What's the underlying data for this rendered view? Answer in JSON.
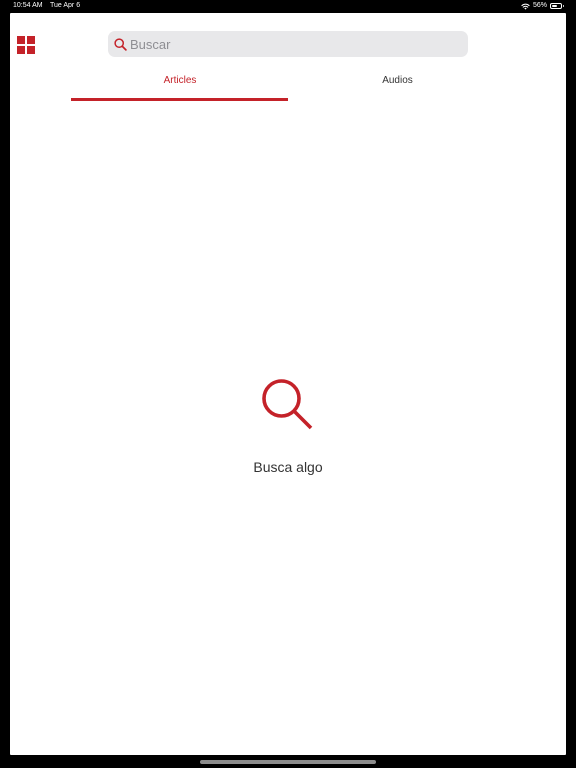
{
  "colors": {
    "accent": "#c42229"
  },
  "status_bar": {
    "time": "10:54 AM",
    "date": "Tue Apr 6",
    "battery": "56%",
    "battery_level": 0.56,
    "icons": [
      "wifi-icon",
      "battery-icon"
    ]
  },
  "header": {
    "menu_icon": "grid-menu-icon",
    "search": {
      "icon": "search-icon",
      "placeholder": "Buscar",
      "value": ""
    }
  },
  "tabs": [
    {
      "label": "Articles",
      "selected": true
    },
    {
      "label": "Audios",
      "selected": false
    }
  ],
  "empty_state": {
    "icon": "search-icon",
    "message": "Busca algo"
  }
}
